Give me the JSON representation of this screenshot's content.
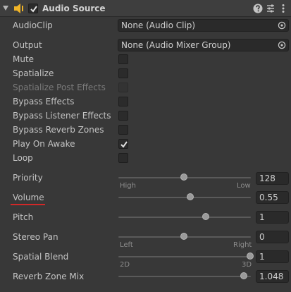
{
  "header": {
    "title": "Audio Source",
    "enabled": true
  },
  "fields": {
    "audio_clip": {
      "label": "AudioClip",
      "value": "None (Audio Clip)"
    },
    "output": {
      "label": "Output",
      "value": "None (Audio Mixer Group)"
    },
    "mute": {
      "label": "Mute",
      "checked": false
    },
    "spatialize": {
      "label": "Spatialize",
      "checked": false
    },
    "spatialize_post_effects": {
      "label": "Spatialize Post Effects",
      "checked": false,
      "disabled": true
    },
    "bypass_effects": {
      "label": "Bypass Effects",
      "checked": false
    },
    "bypass_listener_effects": {
      "label": "Bypass Listener Effects",
      "checked": false
    },
    "bypass_reverb_zones": {
      "label": "Bypass Reverb Zones",
      "checked": false
    },
    "play_on_awake": {
      "label": "Play On Awake",
      "checked": true
    },
    "loop": {
      "label": "Loop",
      "checked": false
    }
  },
  "sliders": {
    "priority": {
      "label": "Priority",
      "value": "128",
      "fraction": 0.502,
      "min_label": "High",
      "max_label": "Low"
    },
    "volume": {
      "label": "Volume",
      "value": "0.55",
      "fraction": 0.55
    },
    "pitch": {
      "label": "Pitch",
      "value": "1",
      "fraction": 0.667
    },
    "stereo_pan": {
      "label": "Stereo Pan",
      "value": "0",
      "fraction": 0.5,
      "min_label": "Left",
      "max_label": "Right"
    },
    "spatial_blend": {
      "label": "Spatial Blend",
      "value": "1",
      "fraction": 1.0,
      "min_label": "2D",
      "max_label": "3D"
    },
    "reverb_zone_mix": {
      "label": "Reverb Zone Mix",
      "value": "1.048",
      "fraction": 0.95
    }
  },
  "colors": {
    "background": "#383838",
    "highlight_underline": "#d22828"
  }
}
